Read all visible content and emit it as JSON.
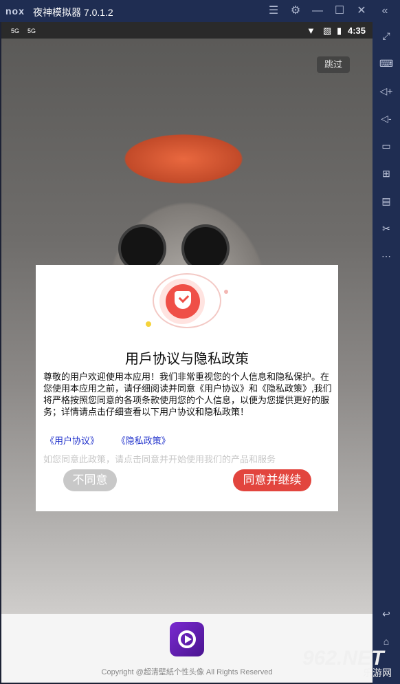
{
  "window": {
    "logo": "nox",
    "title": "夜神模拟器 7.0.1.2"
  },
  "status": {
    "sig1": "5G",
    "sig2": "5G",
    "time": "4:35"
  },
  "skip_label": "跳过",
  "dialog": {
    "title": "用戶协议与隐私政策",
    "body": "尊敬的用户欢迎使用本应用！我们非常重视您的个人信息和隐私保护。在您使用本应用之前，请仔细阅读并同意《用户协议》和《隐私政策》,我们将严格按照您同意的各项条款使用您的个人信息，以便为您提供更好的服务；详情请点击仔细查看以下用户协议和隐私政策！",
    "link_agreement": "《用户协议》",
    "link_privacy": "《隐私政策》",
    "hint": "如您同意此政策，请点击同意并开始使用我们的产品和服务",
    "decline": "不同意",
    "accept": "同意并继续"
  },
  "footer": {
    "copyright": "Copyright @超清壁紙个性头像 All Rights Reserved"
  },
  "watermark": {
    "big": "962.NET",
    "small": "乐游网"
  }
}
